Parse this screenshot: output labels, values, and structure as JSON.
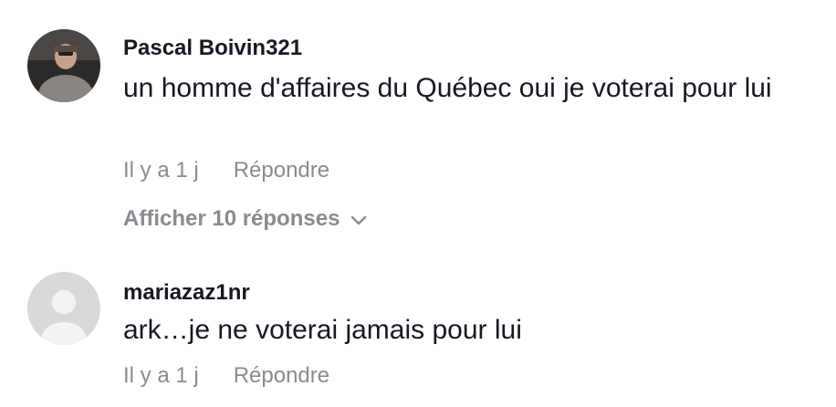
{
  "comments": [
    {
      "username": "Pascal Boivin321",
      "text": "un homme d'affaires du Québec oui je voterai pour lui",
      "time": "Il y a 1 j",
      "reply_label": "Répondre",
      "view_replies_label": "Afficher 10 réponses",
      "avatar_icon": "user-photo-avatar"
    },
    {
      "username": "mariazaz1nr",
      "text": "ark…je ne voterai jamais pour lui",
      "time": "Il y a 1 j",
      "reply_label": "Répondre",
      "avatar_icon": "default-user-avatar-icon"
    }
  ],
  "colors": {
    "primary_text": "#161823",
    "secondary_text": "#8a8b91",
    "default_avatar_bg": "#d9d9db"
  }
}
